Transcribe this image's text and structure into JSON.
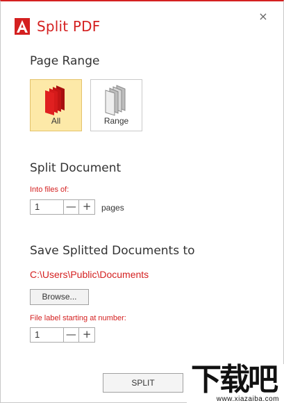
{
  "window": {
    "title": "Split PDF",
    "accent_color": "#d42020",
    "close_icon": "close-icon",
    "close_glyph": "×"
  },
  "page_range": {
    "heading": "Page Range",
    "options": [
      {
        "label": "All",
        "icon": "all-pages-icon",
        "selected": true
      },
      {
        "label": "Range",
        "icon": "range-pages-icon",
        "selected": false
      }
    ]
  },
  "split_document": {
    "heading": "Split Document",
    "into_files_label": "Into files of:",
    "pages_value": "1",
    "minus_glyph": "—",
    "plus_glyph": "+",
    "pages_unit": "pages"
  },
  "save": {
    "heading": "Save Splitted Documents to",
    "path": "C:\\Users\\Public\\Documents",
    "browse_label": "Browse...",
    "file_label_caption": "File label starting at number:",
    "start_number": "1"
  },
  "actions": {
    "split_label": "SPLIT"
  }
}
